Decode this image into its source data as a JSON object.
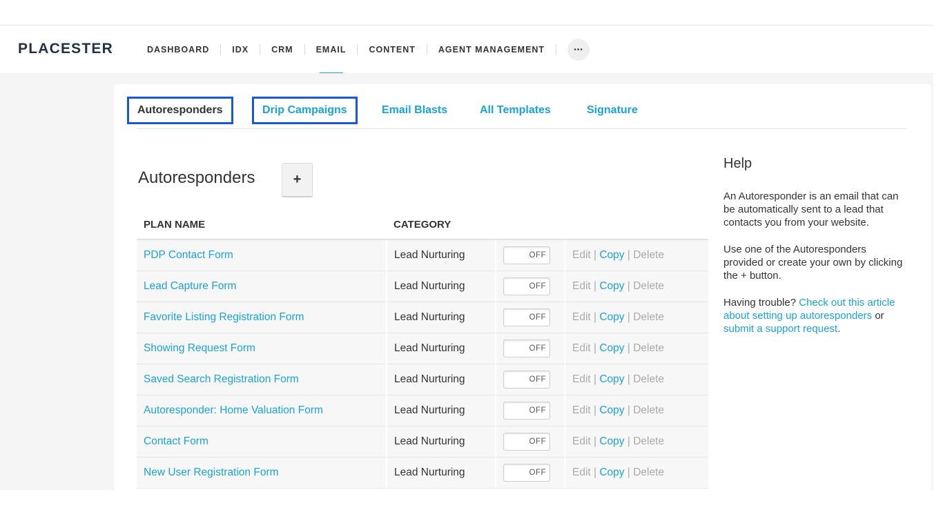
{
  "brand": "PLACESTER",
  "nav": {
    "items": [
      "DASHBOARD",
      "IDX",
      "CRM",
      "EMAIL",
      "CONTENT",
      "AGENT MANAGEMENT"
    ],
    "active": "EMAIL",
    "more_label": "•••"
  },
  "subnav": {
    "tabs": [
      "Autoresponders",
      "Drip Campaigns",
      "Email Blasts",
      "All Templates",
      "Signature"
    ],
    "active": "Autoresponders"
  },
  "section": {
    "title": "Autoresponders",
    "add_label": "+"
  },
  "table": {
    "headers": [
      "PLAN NAME",
      "CATEGORY"
    ],
    "rows": [
      {
        "name": "PDP Contact Form",
        "category": "Lead Nurturing",
        "toggle": "OFF"
      },
      {
        "name": "Lead Capture Form",
        "category": "Lead Nurturing",
        "toggle": "OFF"
      },
      {
        "name": "Favorite Listing Registration Form",
        "category": "Lead Nurturing",
        "toggle": "OFF"
      },
      {
        "name": "Showing Request Form",
        "category": "Lead Nurturing",
        "toggle": "OFF"
      },
      {
        "name": "Saved Search Registration Form",
        "category": "Lead Nurturing",
        "toggle": "OFF"
      },
      {
        "name": "Autoresponder: Home Valuation Form",
        "category": "Lead Nurturing",
        "toggle": "OFF"
      },
      {
        "name": "Contact Form",
        "category": "Lead Nurturing",
        "toggle": "OFF"
      },
      {
        "name": "New User Registration Form",
        "category": "Lead Nurturing",
        "toggle": "OFF"
      }
    ],
    "actions": {
      "edit": "Edit",
      "copy": "Copy",
      "delete": "Delete",
      "separator": " | "
    }
  },
  "help": {
    "title": "Help",
    "p1": "An Autoresponder is an email that can be automatically sent to a lead that contacts you from your website.",
    "p2": "Use one of the Autoresponders provided or create your own by clicking the + button.",
    "p3_prefix": "Having trouble? ",
    "p3_link1": "Check out this article about setting up autoresponders",
    "p3_mid": " or ",
    "p3_link2": "submit a support request",
    "p3_suffix": "."
  },
  "colors": {
    "accent": "#1aa3d9",
    "highlight_box": "#1758d6",
    "brand_text": "#1f3244"
  }
}
